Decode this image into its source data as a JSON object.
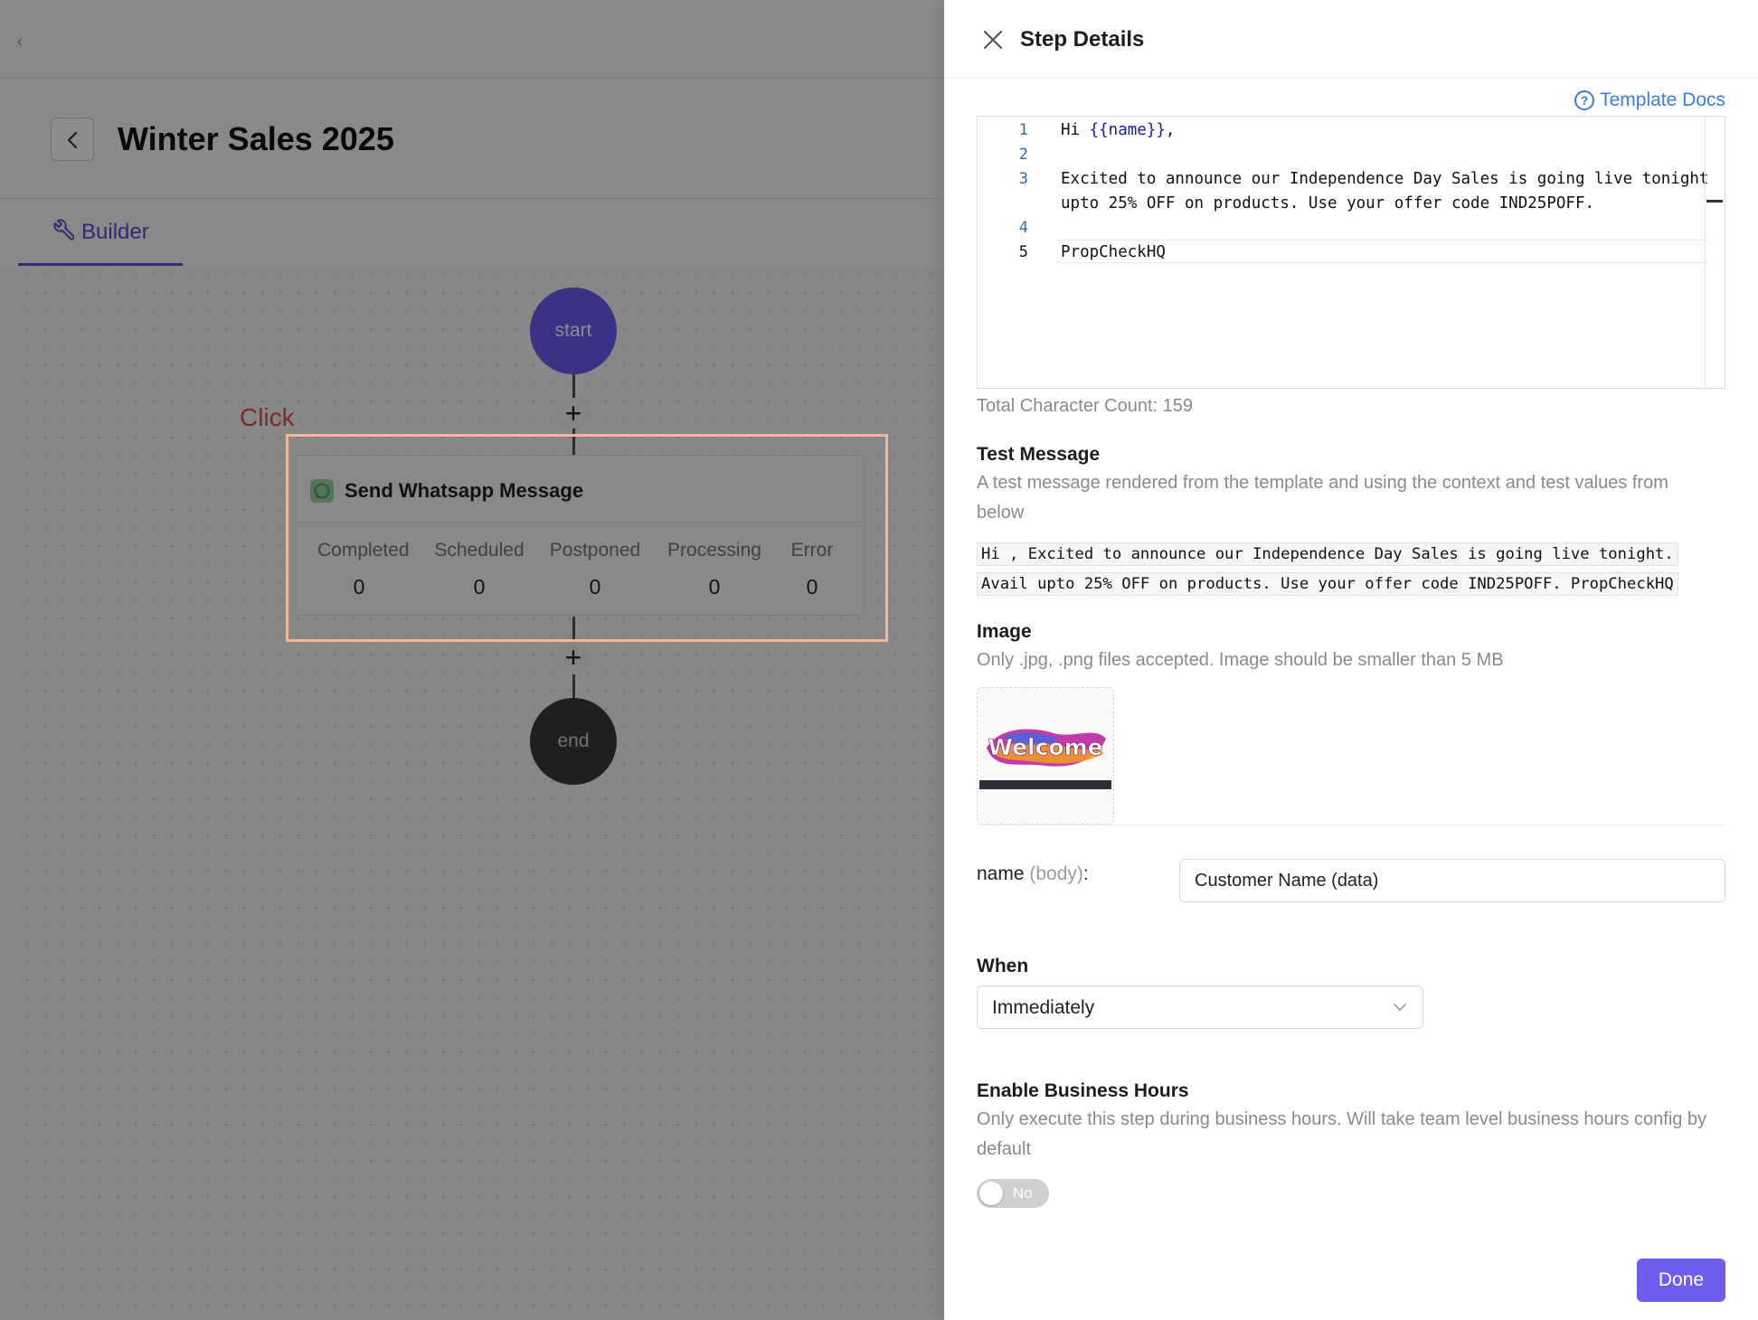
{
  "builder": {
    "page_title": "Winter Sales 2025",
    "tab_builder_label": "Builder",
    "start_label": "start",
    "end_label": "end",
    "annotation_label": "Click",
    "step": {
      "title": "Send Whatsapp Message",
      "stats": [
        {
          "label": "Completed",
          "value": "0"
        },
        {
          "label": "Scheduled",
          "value": "0"
        },
        {
          "label": "Postponed",
          "value": "0"
        },
        {
          "label": "Processing",
          "value": "0"
        },
        {
          "label": "Error",
          "value": "0"
        }
      ]
    }
  },
  "drawer": {
    "title": "Step Details",
    "docs_link_label": "Template Docs",
    "editor": {
      "line_numbers": [
        "1",
        "2",
        "3",
        "4",
        "5"
      ],
      "line1_prefix": "Hi ",
      "line1_var": "{{name}}",
      "line1_suffix": ",",
      "line3a": "Excited to announce our Independence Day Sales is going live tonight",
      "line3b": "upto 25% OFF on products. Use your offer code IND25POFF.",
      "line5": "PropCheckHQ"
    },
    "char_count": "Total Character Count: 159",
    "test_message": {
      "label": "Test Message",
      "description": "A test message rendered from the template and using the context and test values from below",
      "rendered": "Hi , Excited to announce our Independence Day Sales is going live tonight. Avail upto 25% OFF on products. Use your offer code IND25POFF. PropCheckHQ"
    },
    "image": {
      "label": "Image",
      "description": "Only .jpg, .png files accepted. Image should be smaller than 5 MB",
      "thumbnail_text": "Welcome"
    },
    "name_field": {
      "label": "name",
      "label_suffix": "(body)",
      "colon": ":",
      "value": "Customer Name (data)"
    },
    "when": {
      "label": "When",
      "selected": "Immediately"
    },
    "business_hours": {
      "label": "Enable Business Hours",
      "description": "Only execute this step during business hours. Will take team level business hours config by default",
      "toggle_label": "No",
      "enabled": false
    },
    "done_label": "Done"
  },
  "colors": {
    "accent": "#6d5ef0",
    "link": "#3b7ddd",
    "annotation": "#e8503a",
    "highlight_border": "#f7b597"
  }
}
